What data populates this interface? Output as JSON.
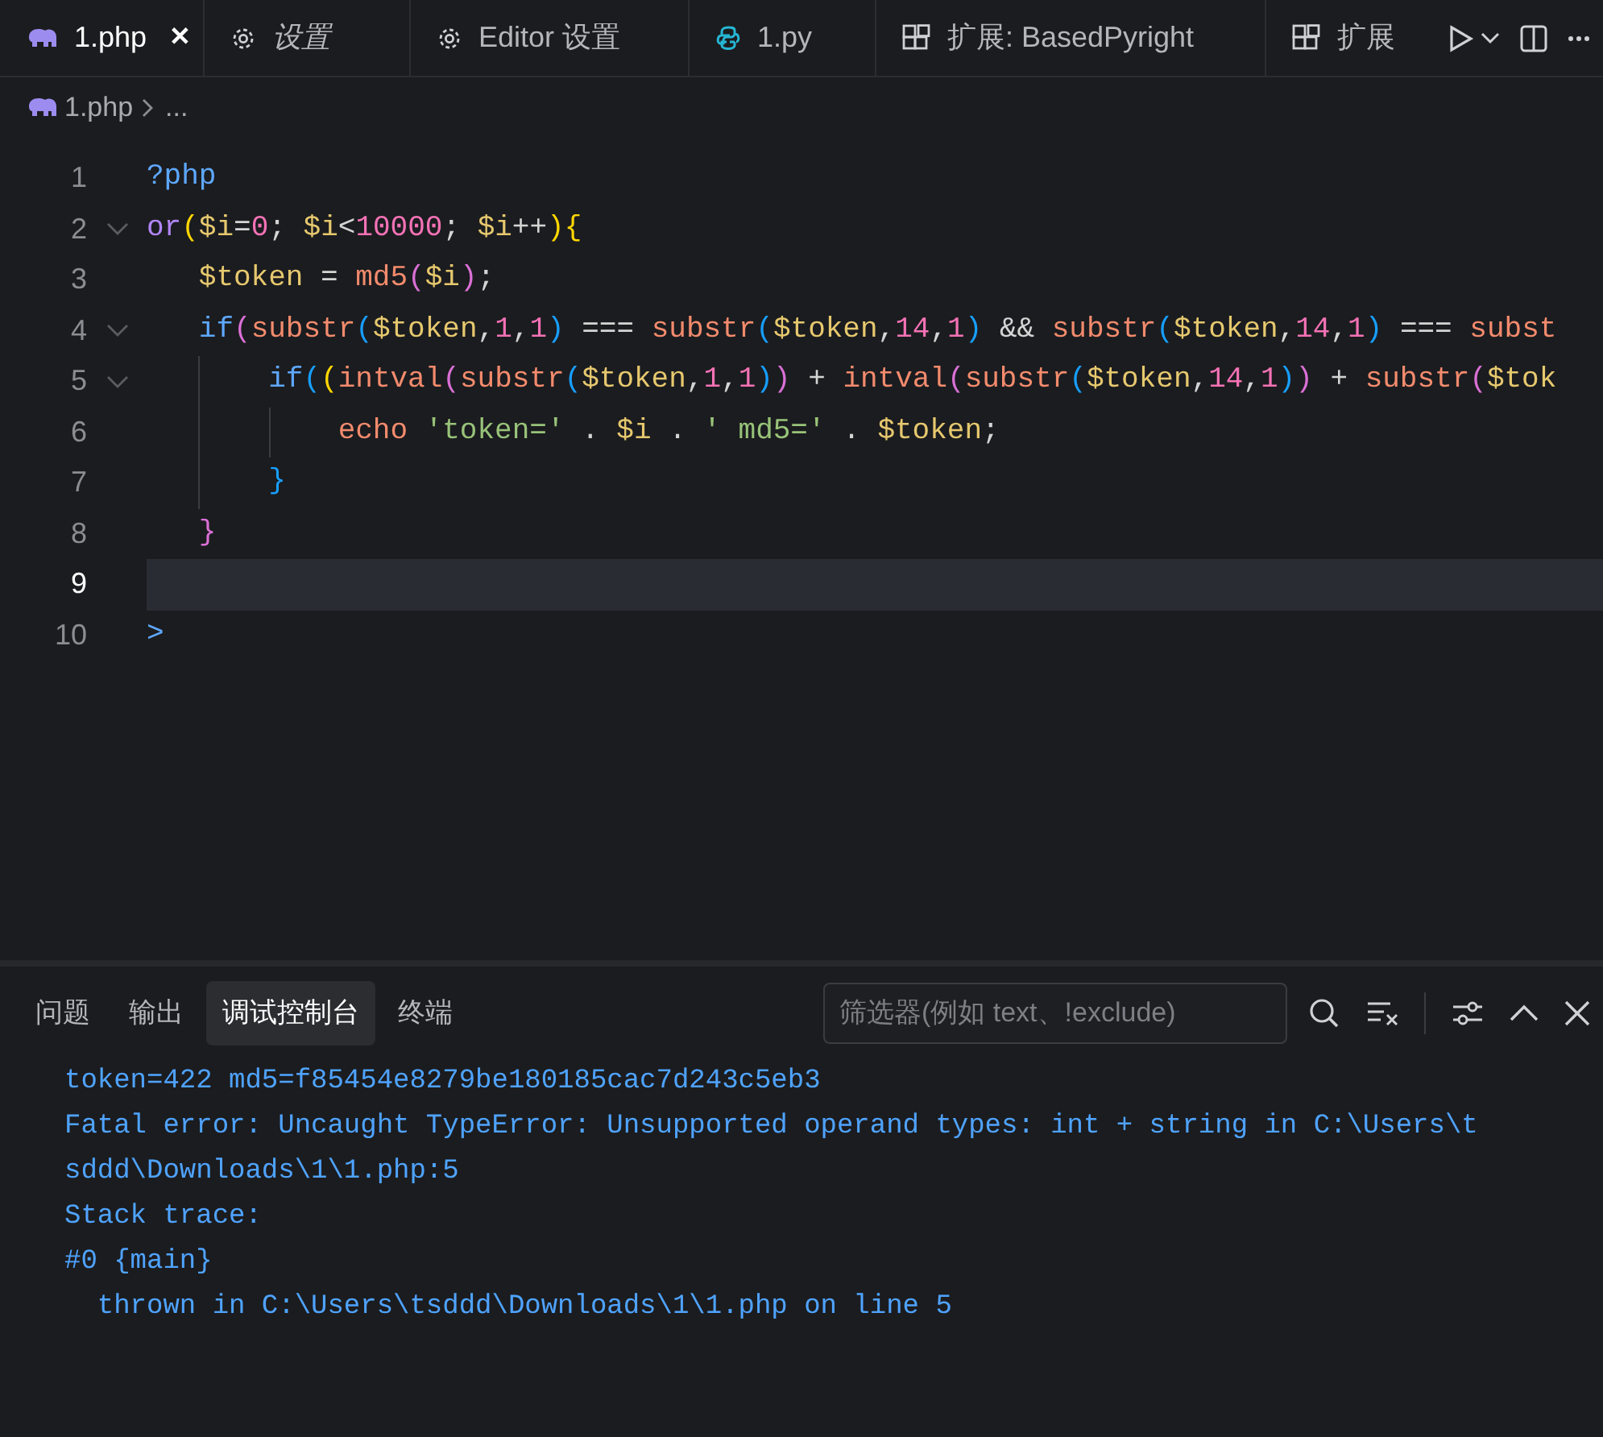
{
  "tabs": [
    {
      "label": "1.php",
      "kind": "php",
      "selected": true,
      "preview": false,
      "closable": true
    },
    {
      "label": "设置",
      "kind": "gear",
      "selected": false,
      "preview": true,
      "closable": false
    },
    {
      "label": "Editor 设置",
      "kind": "gear",
      "selected": false,
      "preview": false,
      "closable": false
    },
    {
      "label": "1.py",
      "kind": "python",
      "selected": false,
      "preview": false,
      "closable": false
    },
    {
      "label": "扩展: BasedPyright",
      "kind": "extensions",
      "selected": false,
      "preview": false,
      "closable": false
    },
    {
      "label": "扩展",
      "kind": "extensions",
      "selected": false,
      "preview": false,
      "closable": false
    }
  ],
  "close_glyph": "✕",
  "breadcrumb": {
    "file": "1.php",
    "rest": "..."
  },
  "editor": {
    "lines": [
      {
        "number": "1",
        "fold": false,
        "current": false,
        "tokens": [
          {
            "kind": "kw",
            "text": "?php"
          }
        ]
      },
      {
        "number": "2",
        "fold": true,
        "current": false,
        "tokens": [
          {
            "kind": "kw2",
            "text": "or"
          },
          {
            "kind": "b1",
            "text": "("
          },
          {
            "kind": "var",
            "text": "$i"
          },
          {
            "kind": "op",
            "text": "="
          },
          {
            "kind": "num",
            "text": "0"
          },
          {
            "kind": "op",
            "text": "; "
          },
          {
            "kind": "var",
            "text": "$i"
          },
          {
            "kind": "op",
            "text": "<"
          },
          {
            "kind": "num",
            "text": "10000"
          },
          {
            "kind": "op",
            "text": "; "
          },
          {
            "kind": "var",
            "text": "$i"
          },
          {
            "kind": "op",
            "text": "++"
          },
          {
            "kind": "b1",
            "text": ")"
          },
          {
            "kind": "b1",
            "text": "{"
          }
        ]
      },
      {
        "number": "3",
        "fold": false,
        "current": false,
        "tokens": [
          {
            "kind": "var",
            "text": "   $token"
          },
          {
            "kind": "op",
            "text": " = "
          },
          {
            "kind": "fn",
            "text": "md5"
          },
          {
            "kind": "b2",
            "text": "("
          },
          {
            "kind": "var",
            "text": "$i"
          },
          {
            "kind": "b2",
            "text": ")"
          },
          {
            "kind": "op",
            "text": ";"
          }
        ]
      },
      {
        "number": "4",
        "fold": true,
        "current": false,
        "tokens": [
          {
            "kind": "kw",
            "text": "   if"
          },
          {
            "kind": "b2",
            "text": "("
          },
          {
            "kind": "fn",
            "text": "substr"
          },
          {
            "kind": "b3",
            "text": "("
          },
          {
            "kind": "var",
            "text": "$token"
          },
          {
            "kind": "op",
            "text": ","
          },
          {
            "kind": "num",
            "text": "1"
          },
          {
            "kind": "op",
            "text": ","
          },
          {
            "kind": "num",
            "text": "1"
          },
          {
            "kind": "b3",
            "text": ")"
          },
          {
            "kind": "op",
            "text": " === "
          },
          {
            "kind": "fn",
            "text": "substr"
          },
          {
            "kind": "b3",
            "text": "("
          },
          {
            "kind": "var",
            "text": "$token"
          },
          {
            "kind": "op",
            "text": ","
          },
          {
            "kind": "num",
            "text": "14"
          },
          {
            "kind": "op",
            "text": ","
          },
          {
            "kind": "num",
            "text": "1"
          },
          {
            "kind": "b3",
            "text": ")"
          },
          {
            "kind": "op",
            "text": " && "
          },
          {
            "kind": "fn",
            "text": "substr"
          },
          {
            "kind": "b3",
            "text": "("
          },
          {
            "kind": "var",
            "text": "$token"
          },
          {
            "kind": "op",
            "text": ","
          },
          {
            "kind": "num",
            "text": "14"
          },
          {
            "kind": "op",
            "text": ","
          },
          {
            "kind": "num",
            "text": "1"
          },
          {
            "kind": "b3",
            "text": ")"
          },
          {
            "kind": "op",
            "text": " === "
          },
          {
            "kind": "fn",
            "text": "subst"
          }
        ]
      },
      {
        "number": "5",
        "fold": true,
        "current": false,
        "tokens": [
          {
            "kind": "kw",
            "text": "       if"
          },
          {
            "kind": "b3",
            "text": "("
          },
          {
            "kind": "b1",
            "text": "("
          },
          {
            "kind": "fn",
            "text": "intval"
          },
          {
            "kind": "b2",
            "text": "("
          },
          {
            "kind": "fn",
            "text": "substr"
          },
          {
            "kind": "b3",
            "text": "("
          },
          {
            "kind": "var",
            "text": "$token"
          },
          {
            "kind": "op",
            "text": ","
          },
          {
            "kind": "num",
            "text": "1"
          },
          {
            "kind": "op",
            "text": ","
          },
          {
            "kind": "num",
            "text": "1"
          },
          {
            "kind": "b3",
            "text": ")"
          },
          {
            "kind": "b2",
            "text": ")"
          },
          {
            "kind": "op",
            "text": " + "
          },
          {
            "kind": "fn",
            "text": "intval"
          },
          {
            "kind": "b2",
            "text": "("
          },
          {
            "kind": "fn",
            "text": "substr"
          },
          {
            "kind": "b3",
            "text": "("
          },
          {
            "kind": "var",
            "text": "$token"
          },
          {
            "kind": "op",
            "text": ","
          },
          {
            "kind": "num",
            "text": "14"
          },
          {
            "kind": "op",
            "text": ","
          },
          {
            "kind": "num",
            "text": "1"
          },
          {
            "kind": "b3",
            "text": ")"
          },
          {
            "kind": "b2",
            "text": ")"
          },
          {
            "kind": "op",
            "text": " + "
          },
          {
            "kind": "fn",
            "text": "substr"
          },
          {
            "kind": "b2",
            "text": "("
          },
          {
            "kind": "var",
            "text": "$tok"
          }
        ]
      },
      {
        "number": "6",
        "fold": false,
        "current": false,
        "tokens": [
          {
            "kind": "fn",
            "text": "           echo"
          },
          {
            "kind": "str",
            "text": " 'token='"
          },
          {
            "kind": "op",
            "text": " . "
          },
          {
            "kind": "var",
            "text": "$i"
          },
          {
            "kind": "op",
            "text": " . "
          },
          {
            "kind": "str",
            "text": "' md5='"
          },
          {
            "kind": "op",
            "text": " . "
          },
          {
            "kind": "var",
            "text": "$token"
          },
          {
            "kind": "op",
            "text": ";"
          }
        ]
      },
      {
        "number": "7",
        "fold": false,
        "current": false,
        "tokens": [
          {
            "kind": "b3",
            "text": "       }"
          }
        ]
      },
      {
        "number": "8",
        "fold": false,
        "current": false,
        "tokens": [
          {
            "kind": "b2",
            "text": "   }"
          }
        ]
      },
      {
        "number": "9",
        "fold": false,
        "current": true
      },
      {
        "number": "10",
        "fold": false,
        "current": false,
        "tokens": [
          {
            "kind": "kw",
            "text": ">"
          }
        ]
      }
    ]
  },
  "panel": {
    "tabs": [
      {
        "label": "问题",
        "selected": false
      },
      {
        "label": "输出",
        "selected": false
      },
      {
        "label": "调试控制台",
        "selected": true
      },
      {
        "label": "终端",
        "selected": false
      }
    ],
    "filter": {
      "placeholder": "筛选器(例如 text、!exclude)"
    },
    "console": [
      "token=422 md5=f85454e8279be180185cac7d243c5eb3",
      "Fatal error: Uncaught TypeError: Unsupported operand types: int + string in C:\\Users\\t",
      "sddd\\Downloads\\1\\1.php:5",
      "Stack trace:",
      "#0 {main}",
      "  thrown in C:\\Users\\tsddd\\Downloads\\1\\1.php on line 5"
    ]
  }
}
